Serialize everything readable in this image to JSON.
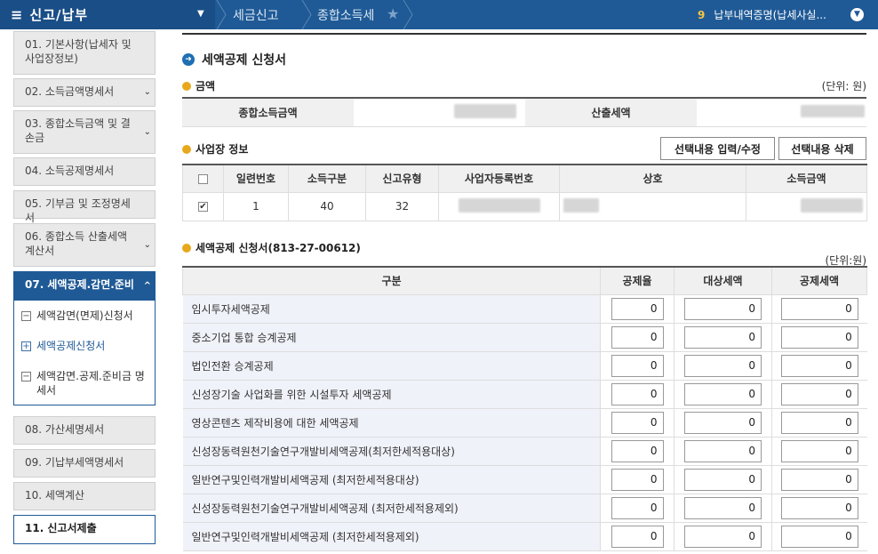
{
  "topbar": {
    "menu_title": "신고/납부",
    "crumbs": [
      "세금신고",
      "종합소득세"
    ],
    "notice_count": "9",
    "notice_text": "납부내역증명(납세사실..."
  },
  "sidebar": {
    "items": [
      {
        "label": "01.  기본사항(납세자 및 사업장정보)"
      },
      {
        "label": "02.  소득금액명세서"
      },
      {
        "label": "03.  종합소득금액 및 결손금"
      },
      {
        "label": "04.  소득공제명세서"
      },
      {
        "label": "05.  기부금 및 조정명세서"
      },
      {
        "label": "06.  종합소득 산출세액계산서"
      },
      {
        "label": "07.  세액공제.감면.준비"
      },
      {
        "label": "08.  가산세명세서"
      },
      {
        "label": "09.  기납부세액명세서"
      },
      {
        "label": "10.  세액계산"
      },
      {
        "label": "11.  신고서제출"
      }
    ],
    "subitems": [
      {
        "label": "세액감면(면제)신청서",
        "box": "−"
      },
      {
        "label": "세액공제신청서",
        "box": "+"
      },
      {
        "label": "세액감면.공제.준비금 명세서",
        "box": "−"
      }
    ]
  },
  "main": {
    "title": "세액공제 신청서",
    "amount": {
      "heading": "금액",
      "unit": "(단위: 원)",
      "label_income": "종합소득금액",
      "label_tax": "산출세액"
    },
    "biz": {
      "heading": "사업장 정보",
      "btn_edit": "선택내용 입력/수정",
      "btn_delete": "선택내용 삭제",
      "columns": [
        "",
        "일련번호",
        "소득구분",
        "신고유형",
        "사업자등록번호",
        "상호",
        "소득금액"
      ],
      "row": {
        "serial": "1",
        "income_type": "40",
        "report_type": "32"
      }
    },
    "credit": {
      "heading": "세액공제 신청서(813-27-00612)",
      "unit": "(단위:원)",
      "columns": [
        "구분",
        "공제율",
        "대상세액",
        "공제세액"
      ],
      "rows": [
        {
          "name": "임시투자세액공제",
          "rate": "0",
          "target": "0",
          "credit": "0"
        },
        {
          "name": "중소기업 통합 승계공제",
          "rate": "0",
          "target": "0",
          "credit": "0"
        },
        {
          "name": "법인전환 승계공제",
          "rate": "0",
          "target": "0",
          "credit": "0"
        },
        {
          "name": "신성장기술 사업화를 위한 시설투자 세액공제",
          "rate": "0",
          "target": "0",
          "credit": "0"
        },
        {
          "name": "영상콘텐츠 제작비용에 대한 세액공제",
          "rate": "0",
          "target": "0",
          "credit": "0"
        },
        {
          "name": "신성장동력원천기술연구개발비세액공제(최저한세적용대상)",
          "rate": "0",
          "target": "0",
          "credit": "0"
        },
        {
          "name": "일반연구및인력개발비세액공제 (최저한세적용대상)",
          "rate": "0",
          "target": "0",
          "credit": "0"
        },
        {
          "name": "신성장동력원천기술연구개발비세액공제 (최저한세적용제외)",
          "rate": "0",
          "target": "0",
          "credit": "0"
        },
        {
          "name": "일반연구및인력개발비세액공제 (최저한세적용제외)",
          "rate": "0",
          "target": "0",
          "credit": "0"
        }
      ]
    }
  }
}
